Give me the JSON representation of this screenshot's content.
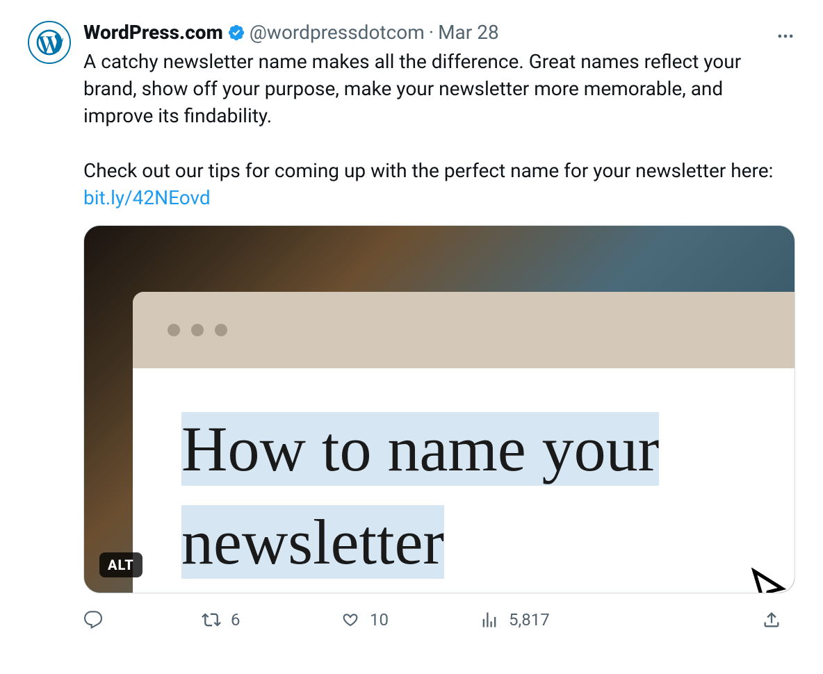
{
  "tweet": {
    "display_name": "WordPress.com",
    "handle": "@wordpressdotcom",
    "date": "Mar 28",
    "text_part1": "A catchy newsletter name makes all the difference. Great names reflect your brand, show off your purpose, make your newsletter more memorable, and improve its findability.",
    "text_part2": "Check out our tips for coming up with the perfect name for your newsletter here: ",
    "link_text": "bit.ly/42NEovd",
    "card": {
      "headline": "How to name your newsletter",
      "alt_label": "ALT"
    },
    "actions": {
      "retweets": "6",
      "likes": "10",
      "views": "5,817"
    }
  }
}
